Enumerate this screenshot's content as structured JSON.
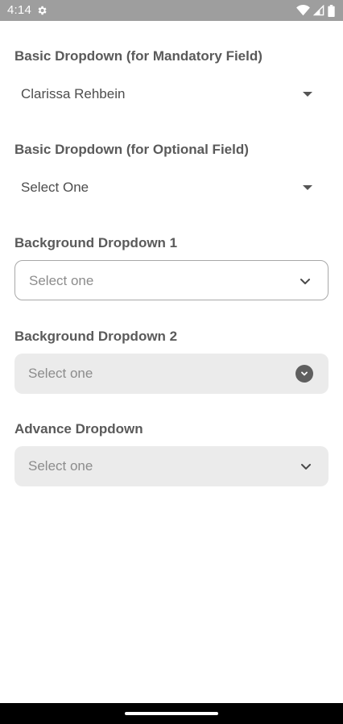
{
  "status_bar": {
    "time": "4:14",
    "icons": [
      "gear-icon",
      "wifi-icon",
      "signal-icon",
      "battery-icon"
    ]
  },
  "sections": [
    {
      "label": "Basic Dropdown (for Mandatory Field)",
      "value": "Clarissa Rehbein"
    },
    {
      "label": "Basic Dropdown (for Optional Field)",
      "value": "Select One"
    },
    {
      "label": "Background Dropdown 1",
      "placeholder": "Select one"
    },
    {
      "label": "Background Dropdown 2",
      "placeholder": "Select one"
    },
    {
      "label": "Advance Dropdown",
      "placeholder": "Select one"
    }
  ],
  "colors": {
    "status_bar": "#9e9e9e",
    "filled_background": "#ebebeb",
    "outline": "#a8a8a8",
    "nav_bar": "#000000"
  }
}
